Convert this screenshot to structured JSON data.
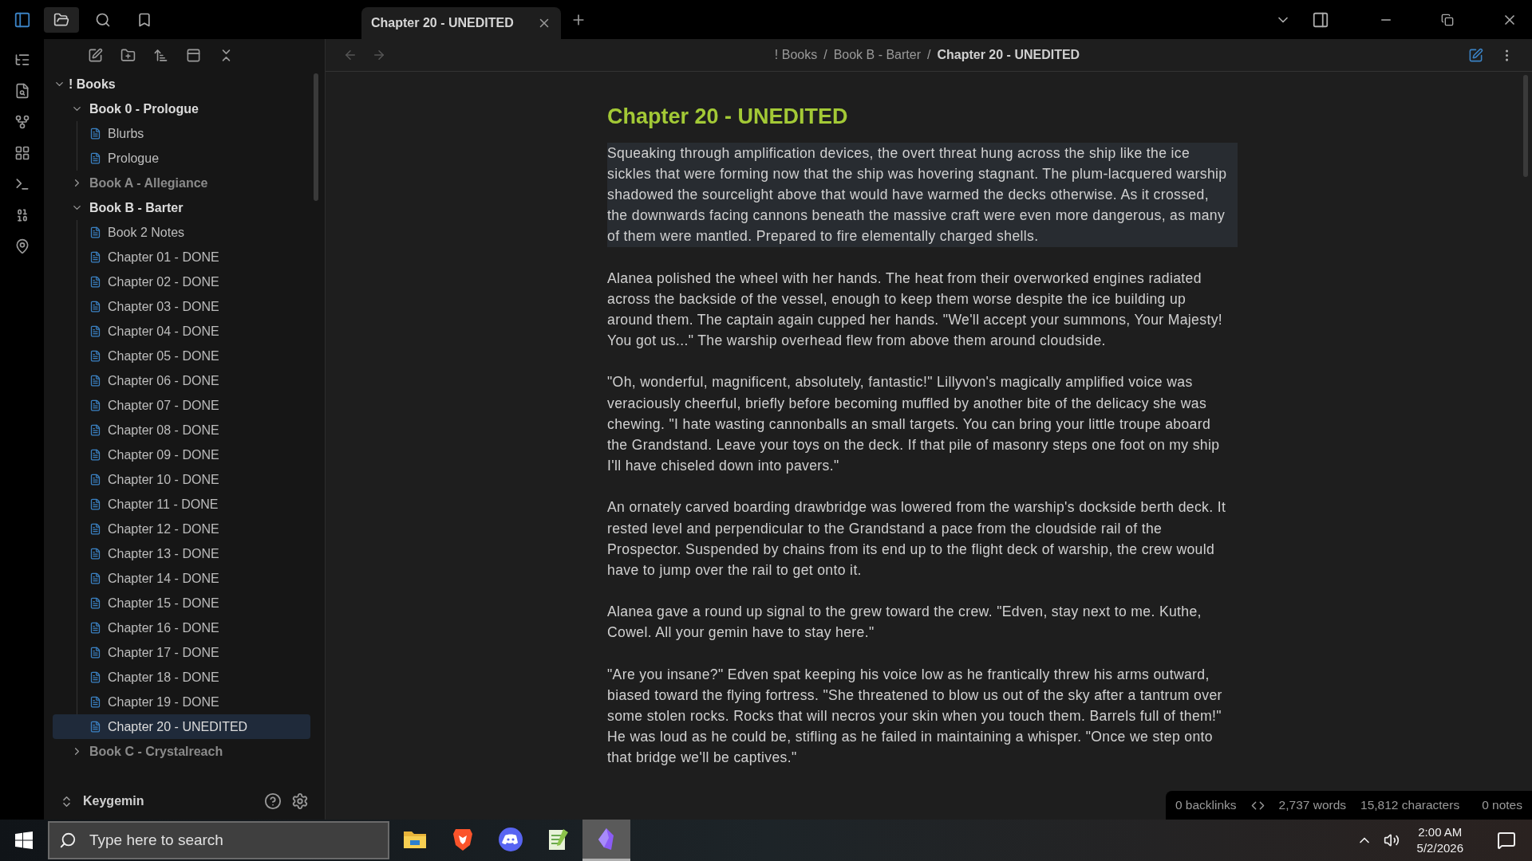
{
  "tabs": [
    {
      "title": "Chapter 20 - UNEDITED",
      "selected": true
    }
  ],
  "breadcrumb": [
    {
      "kind": "crumb",
      "text": "! Books",
      "current": false
    },
    {
      "kind": "separator",
      "text": "/"
    },
    {
      "kind": "crumb",
      "text": "Book B - Barter",
      "current": false
    },
    {
      "kind": "separator",
      "text": "/"
    },
    {
      "kind": "crumb",
      "text": "Chapter 20 - UNEDITED",
      "current": true
    }
  ],
  "file_tree": {
    "name": "! Books",
    "expanded": true,
    "children": [
      {
        "kind": "folder",
        "name": "Book 0 - Prologue",
        "expanded": true,
        "children": [
          {
            "kind": "file",
            "name": "Blurbs",
            "selected": false
          },
          {
            "kind": "file",
            "name": "Prologue",
            "selected": false
          }
        ]
      },
      {
        "kind": "folder",
        "name": "Book A - Allegiance",
        "expanded": false
      },
      {
        "kind": "folder",
        "name": "Book B - Barter",
        "expanded": true,
        "children": [
          {
            "kind": "file",
            "name": "Book 2 Notes",
            "selected": false
          },
          {
            "kind": "file",
            "name": "Chapter 01 - DONE",
            "selected": false
          },
          {
            "kind": "file",
            "name": "Chapter 02 - DONE",
            "selected": false
          },
          {
            "kind": "file",
            "name": "Chapter 03 - DONE",
            "selected": false
          },
          {
            "kind": "file",
            "name": "Chapter 04 - DONE",
            "selected": false
          },
          {
            "kind": "file",
            "name": "Chapter 05 - DONE",
            "selected": false
          },
          {
            "kind": "file",
            "name": "Chapter 06 - DONE",
            "selected": false
          },
          {
            "kind": "file",
            "name": "Chapter 07 - DONE",
            "selected": false
          },
          {
            "kind": "file",
            "name": "Chapter 08 - DONE",
            "selected": false
          },
          {
            "kind": "file",
            "name": "Chapter 09 - DONE",
            "selected": false
          },
          {
            "kind": "file",
            "name": "Chapter 10 - DONE",
            "selected": false
          },
          {
            "kind": "file",
            "name": "Chapter 11 - DONE",
            "selected": false
          },
          {
            "kind": "file",
            "name": "Chapter 12 - DONE",
            "selected": false
          },
          {
            "kind": "file",
            "name": "Chapter 13 - DONE",
            "selected": false
          },
          {
            "kind": "file",
            "name": "Chapter 14 - DONE",
            "selected": false
          },
          {
            "kind": "file",
            "name": "Chapter 15 - DONE",
            "selected": false
          },
          {
            "kind": "file",
            "name": "Chapter 16 - DONE",
            "selected": false
          },
          {
            "kind": "file",
            "name": "Chapter 17 - DONE",
            "selected": false
          },
          {
            "kind": "file",
            "name": "Chapter 18 - DONE",
            "selected": false
          },
          {
            "kind": "file",
            "name": "Chapter 19 - DONE",
            "selected": false
          },
          {
            "kind": "file",
            "name": "Chapter 20 - UNEDITED",
            "selected": true
          }
        ]
      },
      {
        "kind": "folder",
        "name": "Book C - Crystalreach",
        "expanded": false
      }
    ]
  },
  "vault": {
    "name": "Keygemin"
  },
  "document": {
    "title": "Chapter 20 - UNEDITED",
    "paragraphs": [
      {
        "text": "Squeaking through amplification devices, the overt threat hung across the ship like the ice sickles that were forming now that the ship was hovering stagnant. The plum-lacquered warship shadowed the sourcelight above that would have warmed the decks otherwise. As it crossed, the downwards facing cannons beneath the massive craft were even more dangerous, as many of them were mantled. Prepared to fire elementally charged shells.",
        "active": true
      },
      {
        "text": "Alanea polished the wheel with her hands. The heat from their overworked engines radiated across the backside of the vessel, enough to keep them worse despite the ice building up around them. The captain again cupped her hands. \"We'll accept your summons, Your Majesty! You got us...\" The warship overhead flew from above them around cloudside.",
        "active": false
      },
      {
        "text": "\"Oh, wonderful, magnificent, absolutely, fantastic!\" Lillyvon's magically amplified voice was veraciously cheerful, briefly before becoming muffled by another bite of the delicacy she was chewing. \"I hate wasting cannonballs an small targets. You can bring your little troupe aboard the Grandstand. Leave your toys on the deck. If that pile of masonry steps one foot on my ship I'll have chiseled down into pavers.\"",
        "active": false
      },
      {
        "text": "An ornately carved boarding drawbridge was lowered from the warship's dockside berth deck. It rested level and perpendicular to the Grandstand a pace from the cloudside rail of the Prospector. Suspended by chains from its end up to the flight deck of warship, the crew would have to jump over the rail to get onto it.",
        "active": false
      },
      {
        "text": "Alanea gave a round up signal to the grew toward the crew. \"Edven, stay next to me. Kuthe, Cowel. All your gemin have to stay here.\"",
        "active": false
      },
      {
        "text": "\"Are you insane?\" Edven spat keeping his voice low as he frantically threw his arms outward, biased toward the flying fortress. \"She threatened to blow us out of the sky after a tantrum over some stolen rocks. Rocks that will necros your skin when you touch them. Barrels full of them!\" He was loud as he could be, stifling as he failed in maintaining a whisper. \"Once we step onto that bridge we'll be captives.\"",
        "active": false
      }
    ]
  },
  "status_bar": {
    "backlinks": "0 backlinks",
    "words": "2,737 words",
    "characters": "15,812 characters",
    "notes": "0 notes"
  },
  "taskbar": {
    "search": {
      "placeholder": "Type here to search"
    },
    "apps": [
      {
        "kind": "folder",
        "selected": false
      },
      {
        "kind": "browser",
        "selected": false
      },
      {
        "kind": "chat",
        "selected": false
      },
      {
        "kind": "editor",
        "selected": false
      },
      {
        "kind": "notes",
        "selected": true
      }
    ],
    "time": "2:00 AM",
    "date": "5/2/2026"
  }
}
